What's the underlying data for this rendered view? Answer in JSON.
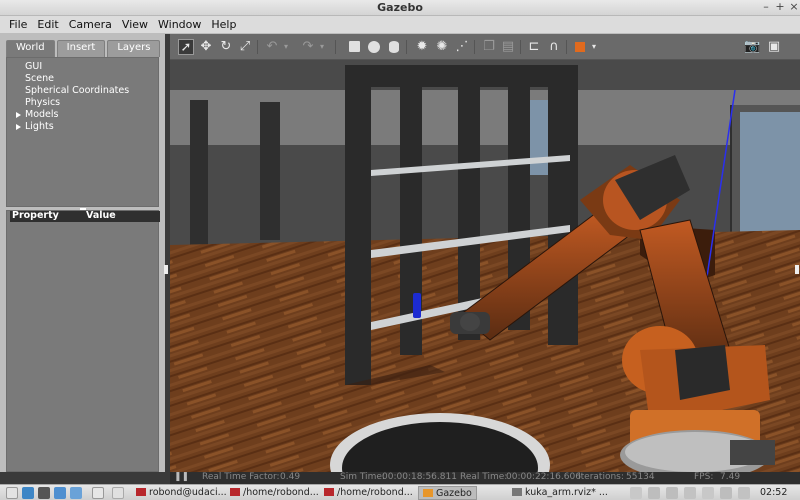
{
  "window": {
    "title": "Gazebo",
    "controls": [
      "–",
      "+",
      "×"
    ]
  },
  "menu": [
    "File",
    "Edit",
    "Camera",
    "View",
    "Window",
    "Help"
  ],
  "left_panel": {
    "tabs": [
      "World",
      "Insert",
      "Layers"
    ],
    "tree": [
      {
        "label": "GUI",
        "expandable": false
      },
      {
        "label": "Scene",
        "expandable": false
      },
      {
        "label": "Spherical Coordinates",
        "expandable": false
      },
      {
        "label": "Physics",
        "expandable": false
      },
      {
        "label": "Models",
        "expandable": true
      },
      {
        "label": "Lights",
        "expandable": true
      }
    ],
    "property_header": "Property",
    "value_header": "Value"
  },
  "toolbar_icons": [
    "select-arrow-icon",
    "translate-icon",
    "rotate-icon",
    "scale-icon",
    "undo-icon",
    "redo-icon",
    "box-icon",
    "sphere-icon",
    "cylinder-icon",
    "point-light-icon",
    "spot-light-icon",
    "directional-light-icon",
    "copy-icon",
    "paste-icon",
    "align-icon",
    "snap-icon",
    "change-view-icon",
    "screenshot-icon",
    "record-icon"
  ],
  "status": {
    "real_time_factor_label": "Real Time Factor:",
    "real_time_factor": "0.49",
    "sim_time_label": "Sim Time:",
    "sim_time": "00:00:18:56.811",
    "real_time_label": "Real Time:",
    "real_time": "00:00:22:16.606",
    "iterations_label": "Iterations:",
    "iterations": "55134",
    "fps_label": "FPS:",
    "fps": "7.49"
  },
  "taskbar": {
    "items": [
      "robond@udaci...",
      "/home/robond...",
      "/home/robond...",
      "Gazebo",
      "kuka_arm.rviz* ..."
    ],
    "clock": "02:52"
  },
  "colors": {
    "accent_orange": "#e06a1e",
    "floor": "#6b3d1f",
    "viewport_bg": "#4b4b4b"
  }
}
